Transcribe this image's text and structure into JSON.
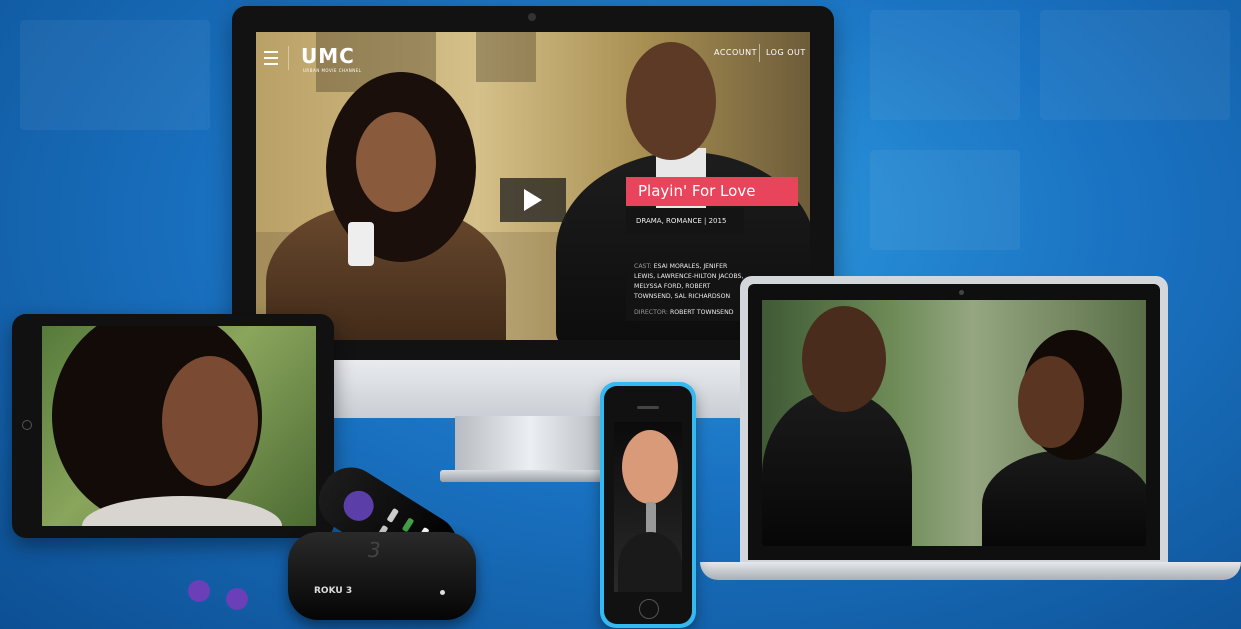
{
  "monitor": {
    "logo": "UMC",
    "logo_subtitle": "URBAN MOVIE CHANNEL",
    "nav": {
      "account": "ACCOUNT",
      "logout": "LOG OUT"
    },
    "title": "Playin' For Love",
    "meta": "DRAMA, ROMANCE | 2015",
    "cast_label": "CAST:",
    "cast": "ESAI MORALES, JENIFER LEWIS, LAWRENCE-HILTON JACOBS, MELYSSA FORD, ROBERT TOWNSEND, SAL RICHARDSON",
    "director_label": "DIRECTOR:",
    "director": "ROBERT TOWNSEND"
  },
  "roku": {
    "label": "ROKU 3",
    "badge": "3"
  },
  "colors": {
    "title_bg": "#e8455c",
    "phone_body": "#36b8f0",
    "roku_purple": "#5b3ea8"
  }
}
